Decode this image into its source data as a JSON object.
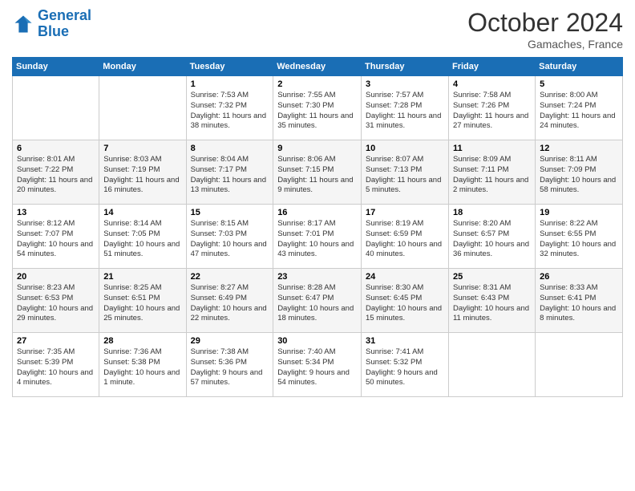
{
  "logo": {
    "line1": "General",
    "line2": "Blue"
  },
  "title": "October 2024",
  "location": "Gamaches, France",
  "days_of_week": [
    "Sunday",
    "Monday",
    "Tuesday",
    "Wednesday",
    "Thursday",
    "Friday",
    "Saturday"
  ],
  "weeks": [
    [
      {
        "day": "",
        "info": ""
      },
      {
        "day": "",
        "info": ""
      },
      {
        "day": "1",
        "info": "Sunrise: 7:53 AM\nSunset: 7:32 PM\nDaylight: 11 hours and 38 minutes."
      },
      {
        "day": "2",
        "info": "Sunrise: 7:55 AM\nSunset: 7:30 PM\nDaylight: 11 hours and 35 minutes."
      },
      {
        "day": "3",
        "info": "Sunrise: 7:57 AM\nSunset: 7:28 PM\nDaylight: 11 hours and 31 minutes."
      },
      {
        "day": "4",
        "info": "Sunrise: 7:58 AM\nSunset: 7:26 PM\nDaylight: 11 hours and 27 minutes."
      },
      {
        "day": "5",
        "info": "Sunrise: 8:00 AM\nSunset: 7:24 PM\nDaylight: 11 hours and 24 minutes."
      }
    ],
    [
      {
        "day": "6",
        "info": "Sunrise: 8:01 AM\nSunset: 7:22 PM\nDaylight: 11 hours and 20 minutes."
      },
      {
        "day": "7",
        "info": "Sunrise: 8:03 AM\nSunset: 7:19 PM\nDaylight: 11 hours and 16 minutes."
      },
      {
        "day": "8",
        "info": "Sunrise: 8:04 AM\nSunset: 7:17 PM\nDaylight: 11 hours and 13 minutes."
      },
      {
        "day": "9",
        "info": "Sunrise: 8:06 AM\nSunset: 7:15 PM\nDaylight: 11 hours and 9 minutes."
      },
      {
        "day": "10",
        "info": "Sunrise: 8:07 AM\nSunset: 7:13 PM\nDaylight: 11 hours and 5 minutes."
      },
      {
        "day": "11",
        "info": "Sunrise: 8:09 AM\nSunset: 7:11 PM\nDaylight: 11 hours and 2 minutes."
      },
      {
        "day": "12",
        "info": "Sunrise: 8:11 AM\nSunset: 7:09 PM\nDaylight: 10 hours and 58 minutes."
      }
    ],
    [
      {
        "day": "13",
        "info": "Sunrise: 8:12 AM\nSunset: 7:07 PM\nDaylight: 10 hours and 54 minutes."
      },
      {
        "day": "14",
        "info": "Sunrise: 8:14 AM\nSunset: 7:05 PM\nDaylight: 10 hours and 51 minutes."
      },
      {
        "day": "15",
        "info": "Sunrise: 8:15 AM\nSunset: 7:03 PM\nDaylight: 10 hours and 47 minutes."
      },
      {
        "day": "16",
        "info": "Sunrise: 8:17 AM\nSunset: 7:01 PM\nDaylight: 10 hours and 43 minutes."
      },
      {
        "day": "17",
        "info": "Sunrise: 8:19 AM\nSunset: 6:59 PM\nDaylight: 10 hours and 40 minutes."
      },
      {
        "day": "18",
        "info": "Sunrise: 8:20 AM\nSunset: 6:57 PM\nDaylight: 10 hours and 36 minutes."
      },
      {
        "day": "19",
        "info": "Sunrise: 8:22 AM\nSunset: 6:55 PM\nDaylight: 10 hours and 32 minutes."
      }
    ],
    [
      {
        "day": "20",
        "info": "Sunrise: 8:23 AM\nSunset: 6:53 PM\nDaylight: 10 hours and 29 minutes."
      },
      {
        "day": "21",
        "info": "Sunrise: 8:25 AM\nSunset: 6:51 PM\nDaylight: 10 hours and 25 minutes."
      },
      {
        "day": "22",
        "info": "Sunrise: 8:27 AM\nSunset: 6:49 PM\nDaylight: 10 hours and 22 minutes."
      },
      {
        "day": "23",
        "info": "Sunrise: 8:28 AM\nSunset: 6:47 PM\nDaylight: 10 hours and 18 minutes."
      },
      {
        "day": "24",
        "info": "Sunrise: 8:30 AM\nSunset: 6:45 PM\nDaylight: 10 hours and 15 minutes."
      },
      {
        "day": "25",
        "info": "Sunrise: 8:31 AM\nSunset: 6:43 PM\nDaylight: 10 hours and 11 minutes."
      },
      {
        "day": "26",
        "info": "Sunrise: 8:33 AM\nSunset: 6:41 PM\nDaylight: 10 hours and 8 minutes."
      }
    ],
    [
      {
        "day": "27",
        "info": "Sunrise: 7:35 AM\nSunset: 5:39 PM\nDaylight: 10 hours and 4 minutes."
      },
      {
        "day": "28",
        "info": "Sunrise: 7:36 AM\nSunset: 5:38 PM\nDaylight: 10 hours and 1 minute."
      },
      {
        "day": "29",
        "info": "Sunrise: 7:38 AM\nSunset: 5:36 PM\nDaylight: 9 hours and 57 minutes."
      },
      {
        "day": "30",
        "info": "Sunrise: 7:40 AM\nSunset: 5:34 PM\nDaylight: 9 hours and 54 minutes."
      },
      {
        "day": "31",
        "info": "Sunrise: 7:41 AM\nSunset: 5:32 PM\nDaylight: 9 hours and 50 minutes."
      },
      {
        "day": "",
        "info": ""
      },
      {
        "day": "",
        "info": ""
      }
    ]
  ]
}
